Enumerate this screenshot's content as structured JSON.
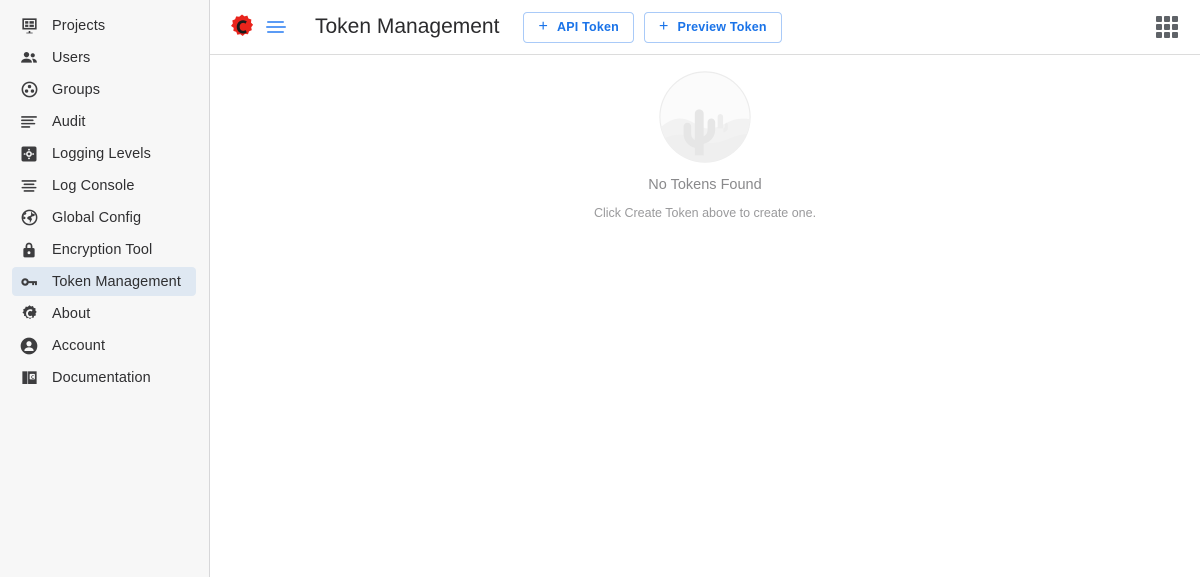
{
  "sidebar": {
    "items": [
      {
        "label": "Projects",
        "icon": "projects-icon",
        "active": false
      },
      {
        "label": "Users",
        "icon": "users-icon",
        "active": false
      },
      {
        "label": "Groups",
        "icon": "groups-icon",
        "active": false
      },
      {
        "label": "Audit",
        "icon": "audit-icon",
        "active": false
      },
      {
        "label": "Logging Levels",
        "icon": "logging-levels-icon",
        "active": false
      },
      {
        "label": "Log Console",
        "icon": "log-console-icon",
        "active": false
      },
      {
        "label": "Global Config",
        "icon": "globe-icon",
        "active": false
      },
      {
        "label": "Encryption Tool",
        "icon": "lock-icon",
        "active": false
      },
      {
        "label": "Token Management",
        "icon": "key-icon",
        "active": true
      },
      {
        "label": "About",
        "icon": "gear-c-icon",
        "active": false
      },
      {
        "label": "Account",
        "icon": "account-circle-icon",
        "active": false
      },
      {
        "label": "Documentation",
        "icon": "book-icon",
        "active": false
      }
    ]
  },
  "header": {
    "logo_icon": "conductor-gear-logo",
    "menu_icon": "hamburger-menu-icon",
    "title": "Token Management",
    "buttons": [
      {
        "label": "API Token",
        "icon": "plus-icon"
      },
      {
        "label": "Preview Token",
        "icon": "plus-icon"
      }
    ],
    "apps_icon": "apps-grid-icon"
  },
  "empty_state": {
    "illustration": "desert-cactus-illustration",
    "title": "No Tokens Found",
    "subtitle": "Click Create Token above to create one."
  },
  "colors": {
    "accent_blue": "#1a73e8",
    "button_border": "#a9caf8",
    "logo_red": "#e8241c",
    "sidebar_bg": "#f7f7f7",
    "active_item_bg": "#dfe8f2",
    "muted_text": "#8a8a8c"
  }
}
